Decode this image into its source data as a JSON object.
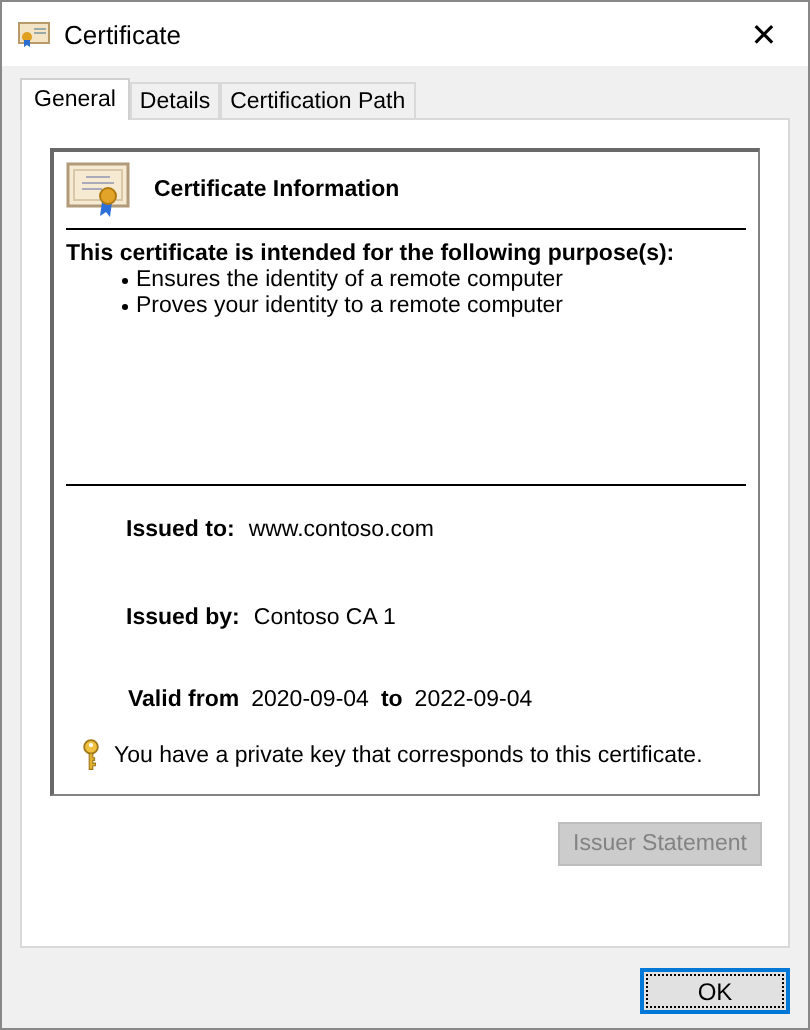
{
  "window": {
    "title": "Certificate",
    "close": "✕"
  },
  "tabs": [
    {
      "label": "General",
      "selected": true
    },
    {
      "label": "Details",
      "selected": false
    },
    {
      "label": "Certification Path",
      "selected": false
    }
  ],
  "info": {
    "heading": "Certificate Information",
    "purpose_title": "This certificate is intended for the following purpose(s):",
    "purposes": [
      "Ensures the identity of a remote computer",
      "Proves your identity to a remote computer"
    ],
    "issued_to": {
      "label": "Issued to:",
      "value": "www.contoso.com"
    },
    "issued_by": {
      "label": "Issued by:",
      "value": "Contoso CA 1"
    },
    "valid": {
      "from_label": "Valid from",
      "from": "2020-09-04",
      "to_label": "to",
      "to": "2022-09-04"
    },
    "key_note": "You have a private key that corresponds to this certificate."
  },
  "issuer_statement": {
    "label": "Issuer Statement",
    "disabled": true
  },
  "ok": {
    "label": "OK",
    "focused": true
  }
}
